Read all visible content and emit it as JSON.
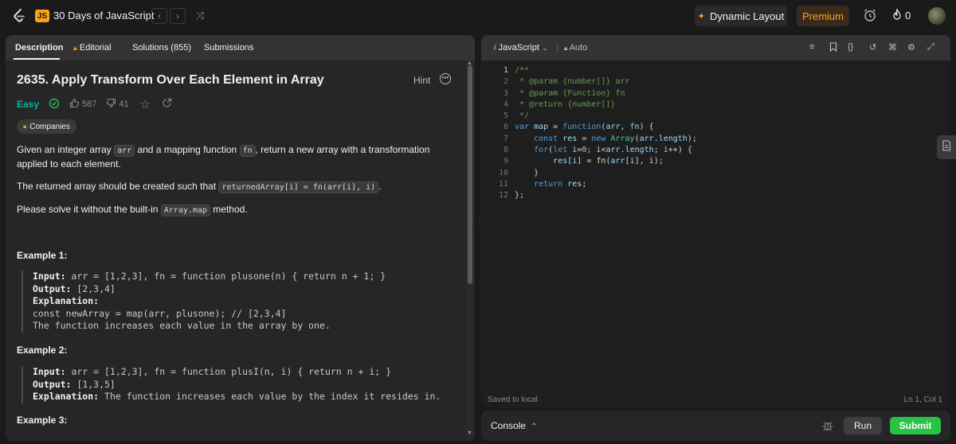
{
  "topnav": {
    "list_badge": "JS",
    "list_title": "30 Days of JavaScript",
    "dynamic_layout": "Dynamic Layout",
    "premium": "Premium",
    "streak": "0"
  },
  "tabs": [
    {
      "label": "Description"
    },
    {
      "label": "Editorial"
    },
    {
      "label": "Solutions (855)"
    },
    {
      "label": "Submissions"
    }
  ],
  "problem": {
    "title": "2635. Apply Transform Over Each Element in Array",
    "hint": "Hint",
    "difficulty": "Easy",
    "likes": "587",
    "dislikes": "41",
    "companies": "Companies",
    "p1_a": "Given an integer array ",
    "p1_code1": "arr",
    "p1_b": " and a mapping function ",
    "p1_code2": "fn",
    "p1_c": ", return a new array with a transformation applied to each element.",
    "p2_a": "The returned array should be created such that ",
    "p2_code": "returnedArray[i] = fn(arr[i], i)",
    "p2_b": ".",
    "p3_a": "Please solve it without the built-in ",
    "p3_code": "Array.map",
    "p3_b": " method."
  },
  "examples": [
    {
      "heading": "Example 1:",
      "input_label": "Input:",
      "input": " arr = [1,2,3], fn = function plusone(n) { return n + 1; }",
      "output_label": "Output:",
      "output": " [2,3,4]",
      "expl_label": "Explanation:",
      "expl_lines": [
        "const newArray = map(arr, plusone); // [2,3,4]",
        "The function increases each value in the array by one."
      ]
    },
    {
      "heading": "Example 2:",
      "input_label": "Input:",
      "input": " arr = [1,2,3], fn = function plusI(n, i) { return n + i; }",
      "output_label": "Output:",
      "output": " [1,3,5]",
      "expl_label": "Explanation:",
      "expl": " The function increases each value by the index it resides in."
    },
    {
      "heading": "Example 3:"
    }
  ],
  "editor": {
    "language": "JavaScript",
    "mode": "Auto",
    "saved": "Saved to local",
    "position": "Ln 1, Col 1",
    "line_numbers": [
      "1",
      "2",
      "3",
      "4",
      "5",
      "6",
      "7",
      "8",
      "9",
      "10",
      "11",
      "12"
    ]
  },
  "bottom": {
    "console": "Console",
    "run": "Run",
    "submit": "Submit"
  },
  "colors": {
    "accent": "#ffa116",
    "easy": "#00b8a3",
    "submit": "#28c244"
  }
}
